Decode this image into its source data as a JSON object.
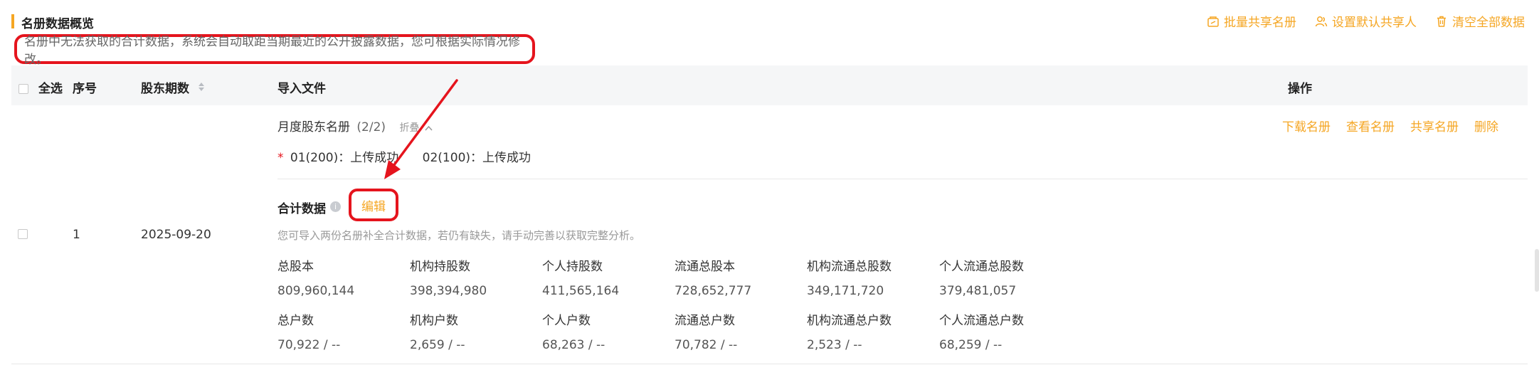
{
  "section": {
    "title": "名册数据概览",
    "notice": "名册中无法获取的合计数据，系统会自动取距当期最近的公开披露数据，您可根据实际情况修改。"
  },
  "toolbar": {
    "bulk_share": "批量共享名册",
    "set_default_sharer": "设置默认共享人",
    "clear_all": "清空全部数据"
  },
  "table": {
    "headers": {
      "select_all": "全选",
      "index": "序号",
      "period": "股东期数",
      "import_file": "导入文件",
      "operation": "操作"
    }
  },
  "row": {
    "index": "1",
    "period": "2025-09-20",
    "roster_title": "月度股东名册",
    "roster_count": "(2/2)",
    "collapse": "折叠",
    "asterisk": "*",
    "file1": "01(200)：上传成功",
    "file2": "02(100)：上传成功",
    "ops": {
      "download": "下载名册",
      "view": "查看名册",
      "share": "共享名册",
      "delete": "删除"
    },
    "totals_title": "合计数据",
    "info": "i",
    "edit": "编辑",
    "totals_hint": "您可导入两份名册补全合计数据，若仍有缺失，请手动完善以获取完整分析。",
    "stats_row1": [
      {
        "label": "总股本",
        "value": "809,960,144"
      },
      {
        "label": "机构持股数",
        "value": "398,394,980"
      },
      {
        "label": "个人持股数",
        "value": "411,565,164"
      },
      {
        "label": "流通总股本",
        "value": "728,652,777"
      },
      {
        "label": "机构流通总股数",
        "value": "349,171,720"
      },
      {
        "label": "个人流通总股数",
        "value": "379,481,057"
      }
    ],
    "stats_row2": [
      {
        "label": "总户数",
        "value": "70,922 / --"
      },
      {
        "label": "机构户数",
        "value": "2,659 / --"
      },
      {
        "label": "个人户数",
        "value": "68,263 / --"
      },
      {
        "label": "流通总户数",
        "value": "70,782 / --"
      },
      {
        "label": "机构流通总户数",
        "value": "2,523 / --"
      },
      {
        "label": "个人流通总户数",
        "value": "68,259 / --"
      }
    ]
  },
  "colors": {
    "accent": "#f5a623",
    "annotation_red": "#e5141d"
  }
}
